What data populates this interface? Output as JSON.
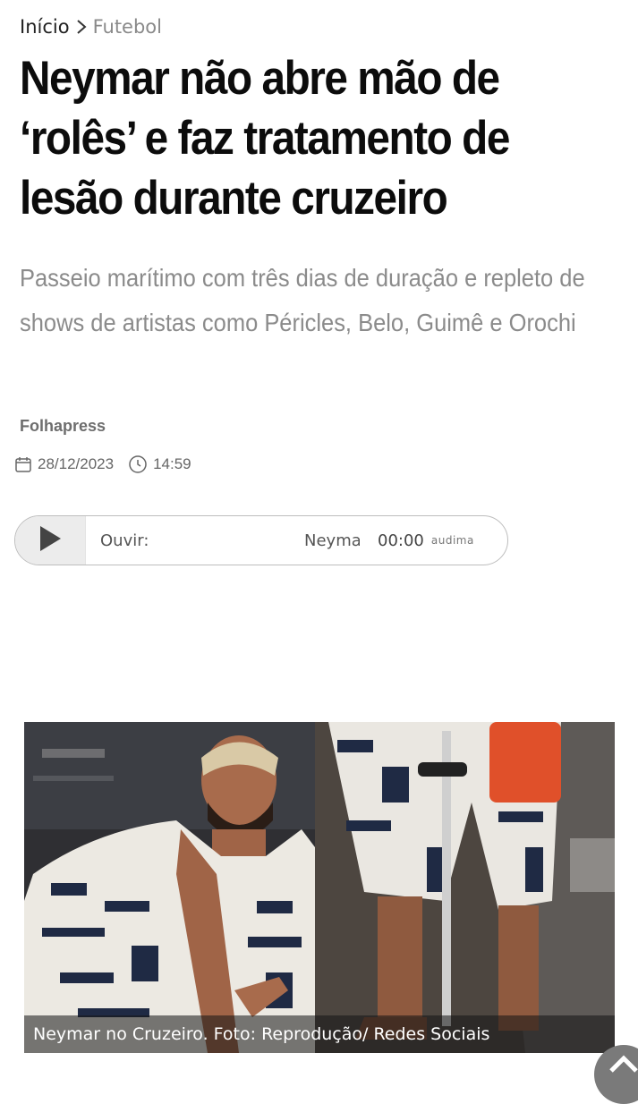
{
  "breadcrumb": {
    "home": "Início",
    "section": "Futebol"
  },
  "article": {
    "headline": "Neymar não abre mão de ‘rolês’ e faz tratamento de lesão durante cruzeiro",
    "subtitle": "Passeio marítimo com três dias de duração e repleto de shows de artistas como Péricles, Belo, Guimê e Orochi",
    "author": "Folhapress",
    "date": "28/12/2023",
    "time": "14:59"
  },
  "audio_player": {
    "label": "Ouvir:",
    "track_title": "Neymar",
    "elapsed": "00:00",
    "brand": "audima"
  },
  "photo": {
    "caption": "Neymar no Cruzeiro. Foto: Reprodução/ Redes Sociais"
  },
  "icons": {
    "breadcrumb_separator": "chevron-right-icon",
    "date": "calendar-icon",
    "time": "clock-icon",
    "play": "play-icon",
    "scroll_top": "chevron-up-icon"
  }
}
